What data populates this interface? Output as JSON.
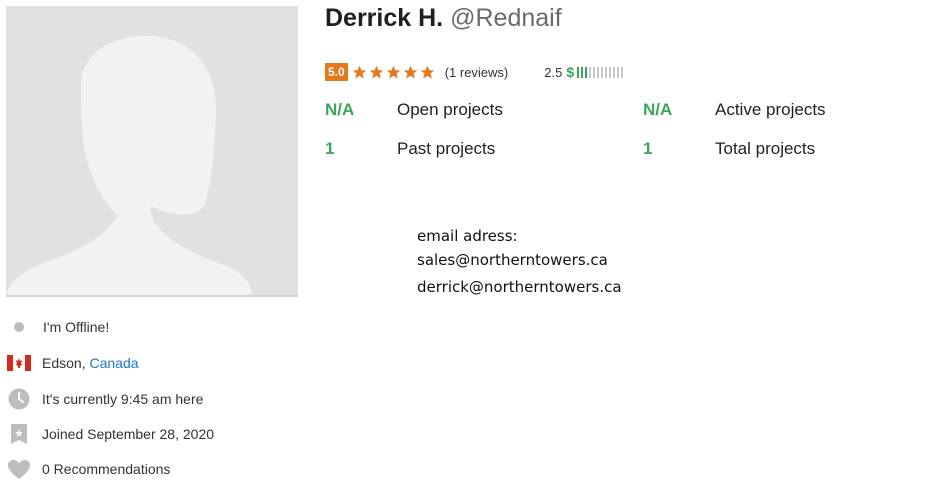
{
  "profile": {
    "name": "Derrick H.",
    "handle": "@Rednaif"
  },
  "rating": {
    "score": "5.0",
    "stars": 5,
    "reviews": "(1 reviews)",
    "earnings_score": "2.5",
    "currency_symbol": "$",
    "earnings_level": 0.25,
    "colors": {
      "badge": "#e8761a",
      "star": "#e8761a",
      "green": "#3ba55c"
    }
  },
  "stats": {
    "open_projects": {
      "value": "N/A",
      "label": "Open projects"
    },
    "active_projects": {
      "value": "N/A",
      "label": "Active projects"
    },
    "past_projects": {
      "value": "1",
      "label": "Past projects"
    },
    "total_projects": {
      "value": "1",
      "label": "Total projects"
    }
  },
  "contact": {
    "heading": "email adress:",
    "email_1": "sales@northerntowers.ca",
    "email_2": "derrick@northerntowers.ca"
  },
  "sidebar": {
    "status": {
      "icon": "offline-dot-icon",
      "text": "I'm Offline!"
    },
    "location": {
      "icon": "canada-flag-icon",
      "city": "Edson",
      "separator": ", ",
      "country": "Canada"
    },
    "local_time": {
      "icon": "clock-icon",
      "text": "It's currently 9:45 am here"
    },
    "joined": {
      "icon": "badge-icon",
      "text": "Joined September 28, 2020"
    },
    "recommendations": {
      "icon": "heart-icon",
      "text": "0 Recommendations"
    }
  }
}
